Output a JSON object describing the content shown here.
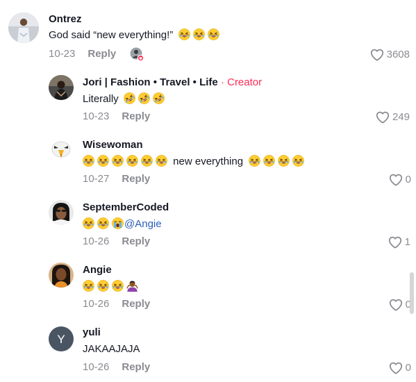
{
  "colors": {
    "meta_gray": "#8a8b91",
    "creator_red": "#fe2c55",
    "mention_blue": "#2b5db9",
    "text_dark": "#161823"
  },
  "comments": [
    {
      "username": "Ontrez",
      "text": "God said “new everything!”",
      "trailing_emojis": [
        "grinning-squinting-face",
        "grinning-squinting-face",
        "grinning-squinting-face"
      ],
      "date": "10-23",
      "reply_label": "Reply",
      "likes": "3608",
      "avatar_icon": "person-avatar",
      "creator_liked_icon": "creator-liked-avatar-icon"
    },
    {
      "username": "Jori | Fashion • Travel • Life",
      "creator_separator": "·",
      "creator_label": "Creator",
      "text": "Literally",
      "trailing_emojis": [
        "rolling-on-floor-laughing",
        "rolling-on-floor-laughing",
        "rolling-on-floor-laughing"
      ],
      "date": "10-23",
      "reply_label": "Reply",
      "likes": "249",
      "avatar_icon": "person-avatar"
    },
    {
      "username": "Wisewoman",
      "text": "new everything",
      "leading_emojis": [
        "grinning-squinting-face",
        "grinning-squinting-face",
        "grinning-squinting-face",
        "grinning-squinting-face",
        "grinning-squinting-face",
        "grinning-squinting-face"
      ],
      "trailing_emojis": [
        "grinning-squinting-face",
        "grinning-squinting-face",
        "grinning-squinting-face",
        "grinning-squinting-face"
      ],
      "date": "10-27",
      "reply_label": "Reply",
      "likes": "0",
      "avatar_icon": "eagle-avatar"
    },
    {
      "username": "SeptemberCoded",
      "mention": "@Angie",
      "leading_emojis": [
        "grinning-squinting-face",
        "grinning-squinting-face",
        "loudly-crying-face"
      ],
      "date": "10-26",
      "reply_label": "Reply",
      "likes": "1",
      "avatar_icon": "person-avatar"
    },
    {
      "username": "Angie",
      "leading_emojis": [
        "grinning-squinting-face",
        "grinning-squinting-face",
        "grinning-squinting-face",
        "person-shrugging"
      ],
      "date": "10-26",
      "reply_label": "Reply",
      "likes": "0",
      "avatar_icon": "person-avatar"
    },
    {
      "username": "yuli",
      "avatar_letter": "Y",
      "text": "JAKAAJAJA",
      "date": "10-26",
      "reply_label": "Reply",
      "likes": "0",
      "avatar_icon": "letter-avatar"
    }
  ]
}
